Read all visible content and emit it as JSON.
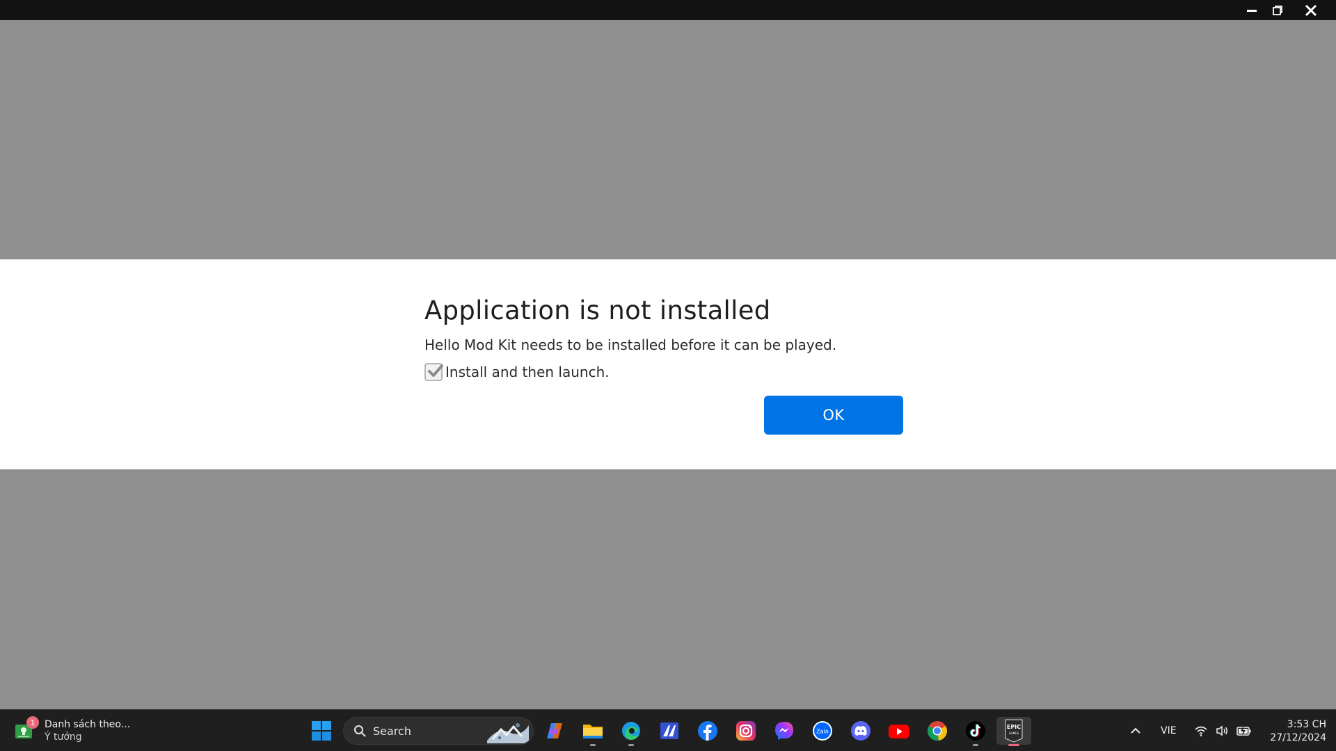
{
  "window": {
    "controls": [
      "minimize-icon",
      "restore-icon",
      "close-icon"
    ]
  },
  "dialog": {
    "title": "Application is not installed",
    "message": "Hello Mod Kit needs to be installed before it can be played.",
    "checkbox_label": "Install and then launch.",
    "checkbox_checked": true,
    "ok_label": "OK",
    "accent_color": "#0074e4"
  },
  "taskbar": {
    "widget": {
      "badge": "1",
      "title": "Danh sách theo...",
      "subtitle": "Ý tưởng"
    },
    "search": {
      "placeholder": "Search"
    },
    "apps": [
      {
        "name": "copilot-icon"
      },
      {
        "name": "file-explorer-icon"
      },
      {
        "name": "edge-icon"
      },
      {
        "name": "microsoft-store-icon"
      },
      {
        "name": "facebook-icon"
      },
      {
        "name": "instagram-icon"
      },
      {
        "name": "messenger-icon"
      },
      {
        "name": "zalo-icon",
        "label": "Zalo"
      },
      {
        "name": "discord-icon"
      },
      {
        "name": "youtube-icon"
      },
      {
        "name": "chrome-icon"
      },
      {
        "name": "tiktok-icon"
      },
      {
        "name": "epic-games-icon",
        "label": "EPIC",
        "sublabel": "GAMES",
        "active": true
      }
    ],
    "tray": {
      "language": "VIE",
      "time": "3:53 CH",
      "date": "27/12/2024"
    }
  }
}
